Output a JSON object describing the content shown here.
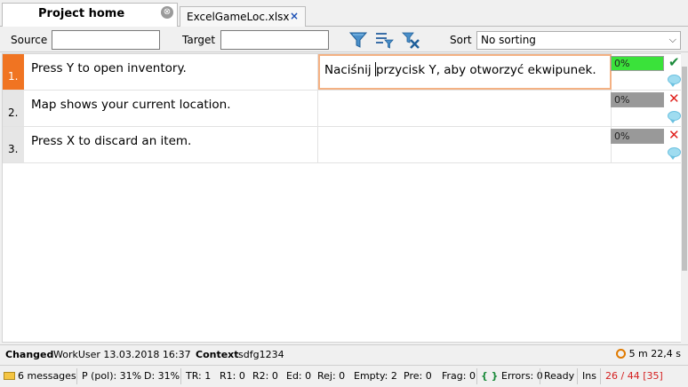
{
  "tabs": [
    {
      "label": "Project home",
      "close": "⊗"
    },
    {
      "label": "ExcelGameLoc.xlsx",
      "close": "×"
    }
  ],
  "toolbar": {
    "source_label": "Source",
    "source_value": "",
    "target_label": "Target",
    "target_value": "",
    "sort_label": "Sort",
    "sort_value": "No sorting"
  },
  "rows": [
    {
      "num": "1.",
      "source": "Press Y to open inventory.",
      "target_before_caret": "Naciśnij ",
      "target_after_caret": "przycisk Y, aby otworzyć ekwipunek.",
      "percent": "0%",
      "status": "✔"
    },
    {
      "num": "2.",
      "source": "Map shows your current location.",
      "target_before_caret": "",
      "target_after_caret": "",
      "percent": "0%",
      "status": "✕"
    },
    {
      "num": "3.",
      "source": "Press X to discard an item.",
      "target_before_caret": "",
      "target_after_caret": "",
      "percent": "0%",
      "status": "✕"
    }
  ],
  "info": {
    "changed_label": "Changed",
    "changed_value": "WorkUser 13.03.2018 16:37",
    "context_label": "Context",
    "context_value": "sdfg1234",
    "timer": "5 m 22,4 s"
  },
  "status": {
    "messages": "6 messages",
    "progress": "P (pol): 31%",
    "done": "D: 31%",
    "tr": "TR: 1",
    "r1": "R1: 0",
    "r2": "R2: 0",
    "ed": "Ed: 0",
    "rej": "Rej: 0",
    "empty": "Empty: 2",
    "pre": "Pre: 0",
    "frag": "Frag: 0",
    "errors_icon": "{ }",
    "errors": "Errors: 0",
    "ready": "Ready",
    "ins": "Ins",
    "position": "26 / 44 [35]"
  },
  "colors": {
    "active_row": "#f07422",
    "progress_full": "#3ae23a",
    "confirmed": "#1a8a3a",
    "rejected": "#e0201c"
  },
  "icons": [
    "filter-icon",
    "filter-list-icon",
    "filter-clear-icon",
    "check-icon",
    "cross-icon",
    "comment-icon",
    "clock-icon",
    "envelope-icon"
  ]
}
